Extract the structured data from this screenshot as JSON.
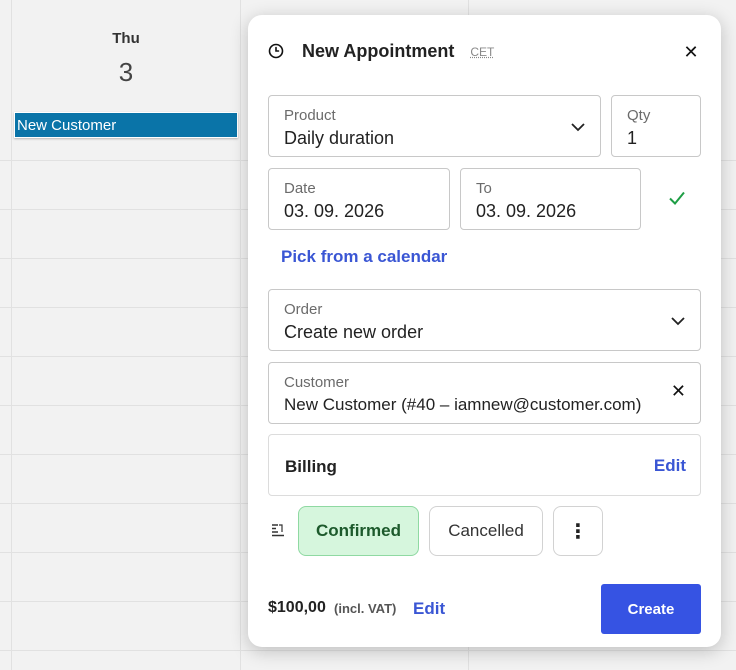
{
  "calendar": {
    "day_name": "Thu",
    "day_number": "3",
    "event_title": "New Customer"
  },
  "dialog": {
    "title": "New Appointment",
    "timezone": "CET",
    "close_icon": "close-icon",
    "product": {
      "label": "Product",
      "value": "Daily duration"
    },
    "qty": {
      "label": "Qty",
      "value": "1"
    },
    "date_from": {
      "label": "Date",
      "value": "03. 09. 2026"
    },
    "date_to": {
      "label": "To",
      "value": "03. 09. 2026"
    },
    "pick_calendar_link": "Pick from a calendar",
    "order": {
      "label": "Order",
      "value": "Create new order"
    },
    "customer": {
      "label": "Customer",
      "value": "New Customer (#40 – iamnew@customer.com)"
    },
    "billing": {
      "title": "Billing",
      "edit_label": "Edit"
    },
    "status": {
      "confirmed_label": "Confirmed",
      "cancelled_label": "Cancelled",
      "more_label": "⋮"
    },
    "footer": {
      "price": "$100,00",
      "vat_note": "(incl. VAT)",
      "edit_label": "Edit",
      "create_label": "Create"
    }
  },
  "colors": {
    "accent": "#3653e3",
    "link": "#3a56d4",
    "event": "#0a74a8",
    "confirmed_bg": "#d6f6dd",
    "check": "#1e9e45"
  }
}
